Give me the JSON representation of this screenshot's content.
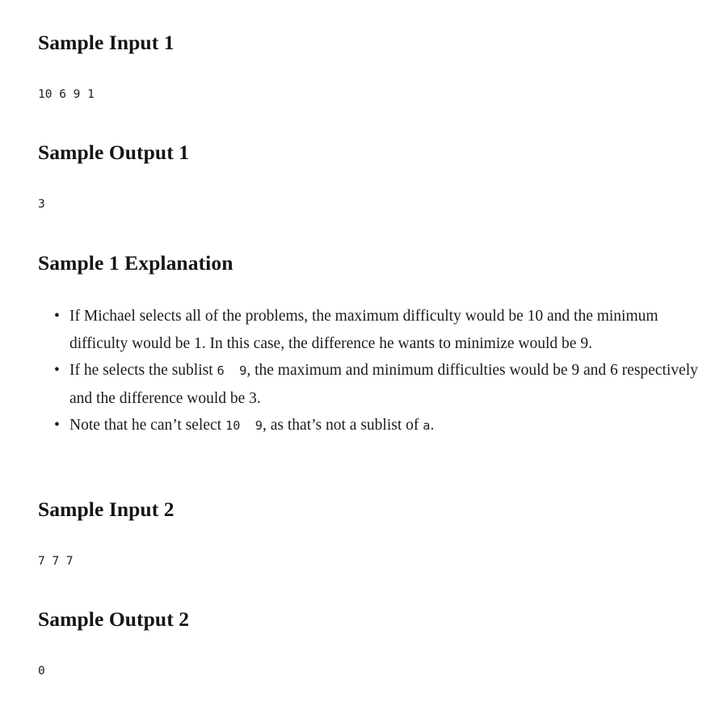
{
  "document": {
    "sections": [
      {
        "heading": "Sample Input 1",
        "code": "10 6 9 1"
      },
      {
        "heading": "Sample Output 1",
        "code": "3"
      },
      {
        "heading": "Sample 1 Explanation",
        "bullets": [
          {
            "parts": [
              {
                "type": "text",
                "value": "If Michael selects all of the problems, the maximum difficulty would be 10 and the minimum difficulty would be 1. In this case, the difference he wants to minimize would be 9."
              }
            ]
          },
          {
            "parts": [
              {
                "type": "text",
                "value": "If he selects the sublist "
              },
              {
                "type": "code",
                "value": "6  9"
              },
              {
                "type": "text",
                "value": ", the maximum and minimum difficulties would be 9 and 6 respectively and the difference would be 3."
              }
            ]
          },
          {
            "parts": [
              {
                "type": "text",
                "value": "Note that he can’t select "
              },
              {
                "type": "code",
                "value": "10  9"
              },
              {
                "type": "text",
                "value": ", as that’s not a sublist of "
              },
              {
                "type": "code",
                "value": "a"
              },
              {
                "type": "text",
                "value": "."
              }
            ]
          }
        ]
      },
      {
        "heading": "Sample Input 2",
        "code": "7 7 7"
      },
      {
        "heading": "Sample Output 2",
        "code": "0"
      }
    ]
  },
  "colors": {
    "background": "#ffffff",
    "body_text": "#1c1c1c",
    "heading_text": "#141414",
    "code_text": "#1f1f1f"
  }
}
